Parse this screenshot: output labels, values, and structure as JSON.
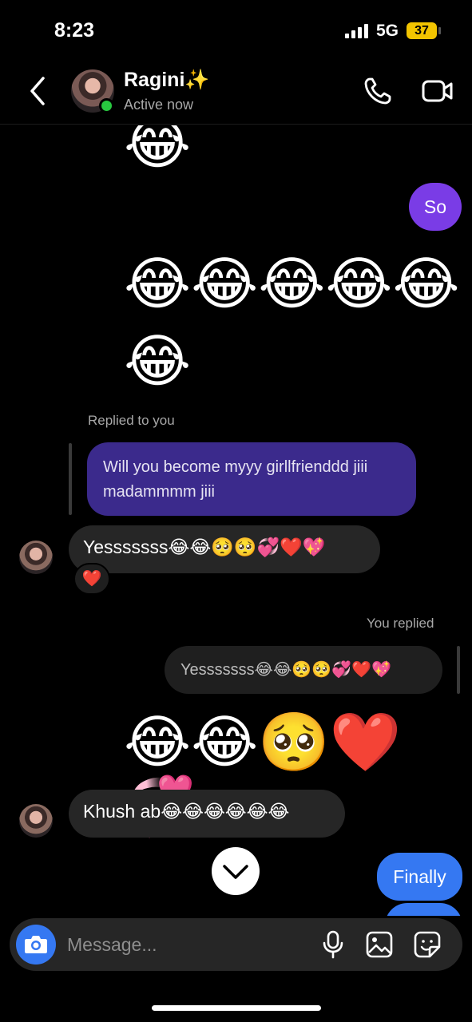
{
  "status_bar": {
    "time": "8:23",
    "network": "5G",
    "battery": "37"
  },
  "header": {
    "name": "Ragini✨",
    "status": "Active now"
  },
  "messages": {
    "top_emoji": "😂",
    "me_so": "So",
    "emoji_row1": "😂😂😂😂😂",
    "emoji_row2": "😂",
    "replied_label": "Replied to you",
    "replied_quote": "Will you become myyy girllfrienddd jiii madammmm jiii",
    "them_yes": "Yesssssss😂😂🥺🥺💞❤️💖",
    "reaction": "❤️",
    "you_replied_label": "You replied",
    "you_replied_quote": "Yesssssss😂😂🥺🥺💞❤️💖",
    "emoji_row3": "😂😂🥺❤️💞",
    "them_khush": "Khush ab😂😂😂😂😂😂",
    "me_finally": "Finally"
  },
  "composer": {
    "placeholder": "Message..."
  },
  "colors": {
    "my_bubble": "#7a3ce6",
    "blue_bubble": "#3578f2",
    "their_bubble": "#262626",
    "online": "#28c840"
  },
  "icons": [
    "back-icon",
    "phone-icon",
    "video-camera-icon",
    "chevron-down-icon",
    "camera-icon",
    "microphone-icon",
    "gallery-icon",
    "sticker-icon"
  ]
}
